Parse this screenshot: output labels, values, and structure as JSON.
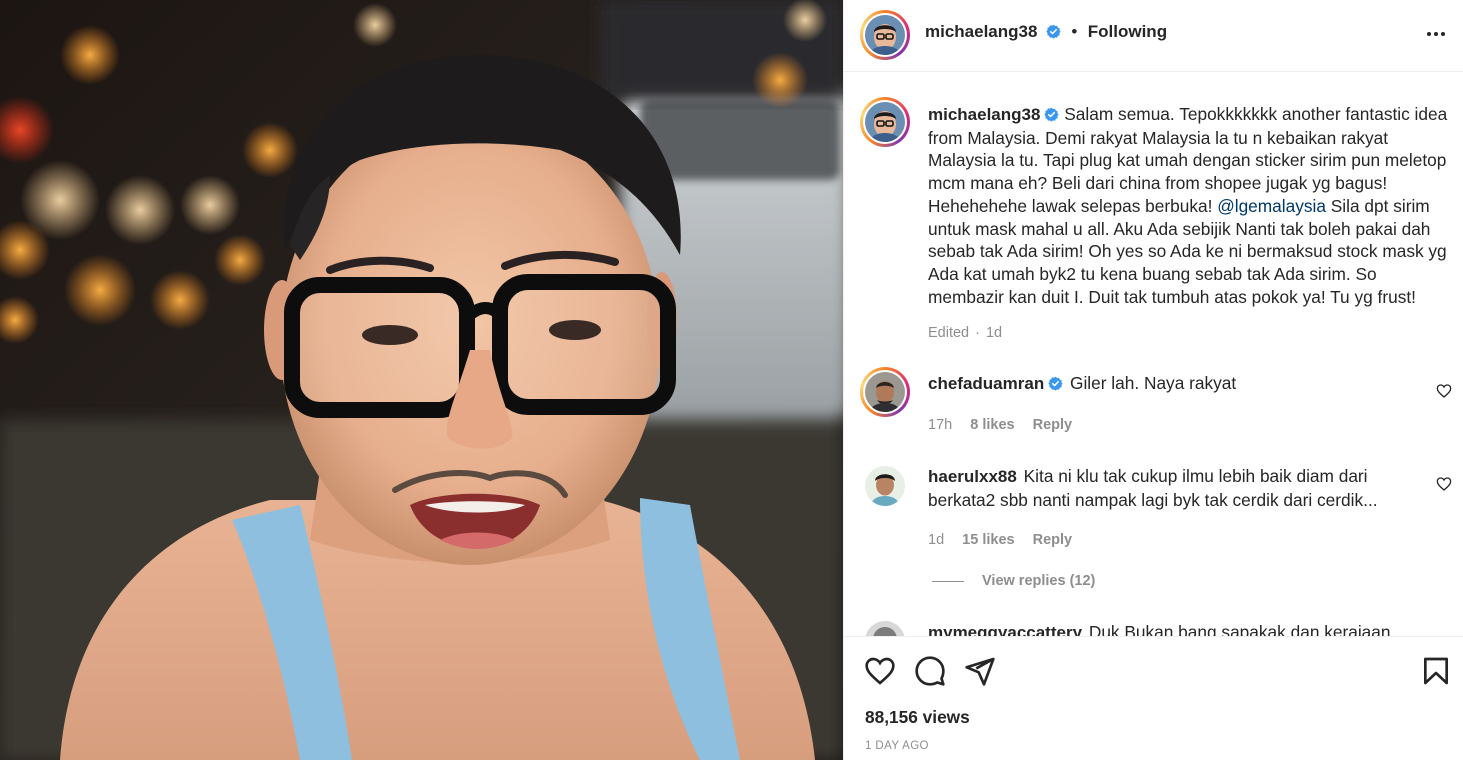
{
  "post": {
    "author": "michaelang38",
    "follow_status": "Following",
    "separator": "•",
    "caption_username": "michaelang38",
    "caption_part1": "Salam semua. Tepokkkkkkk another fantastic idea from Malaysia. Demi rakyat Malaysia la tu n kebaikan rakyat Malaysia la tu. Tapi plug kat umah dengan sticker sirim pun meletop mcm mana eh? Beli dari china from shopee jugak yg bagus! Hehehehehe lawak selepas berbuka! ",
    "caption_mention": "@lgemalaysia",
    "caption_part2": " Sila dpt sirim untuk mask mahal u all. Aku Ada sebijik Nanti tak boleh pakai dah sebab tak Ada sirim! Oh yes so Ada ke ni bermaksud stock mask yg Ada kat umah byk2 tu kena buang sebab tak Ada sirim. So membazir kan duit I. Duit tak tumbuh atas pokok ya! Tu yg frust!",
    "caption_edited": "Edited",
    "caption_time": "1d"
  },
  "comments": [
    {
      "username": "chefaduamran",
      "verified": true,
      "text": "Giler lah. Naya rakyat",
      "time": "17h",
      "likes": "8 likes",
      "reply": "Reply"
    },
    {
      "username": "haerulxx88",
      "verified": false,
      "text": "Kita ni klu tak cukup ilmu lebih baik diam dari berkata2 sbb nanti nampak lagi byk tak cerdik dari cerdik...",
      "time": "1d",
      "likes": "15 likes",
      "reply": "Reply",
      "view_replies": "View replies (12)"
    },
    {
      "username": "mymeggyaccattery",
      "text": "Duk Bukan bang sapakak dan kerajaan"
    }
  ],
  "footer": {
    "views": "88,156 views",
    "time_ago": "1 DAY AGO"
  },
  "icons": {
    "more": "more-options-icon",
    "like": "heart-icon",
    "comment": "comment-icon",
    "share": "share-icon",
    "save": "bookmark-icon"
  },
  "colors": {
    "verified_badge": "#3897f0",
    "mention": "#00376b",
    "muted_text": "#8e8e8e",
    "primary_text": "#262626"
  }
}
